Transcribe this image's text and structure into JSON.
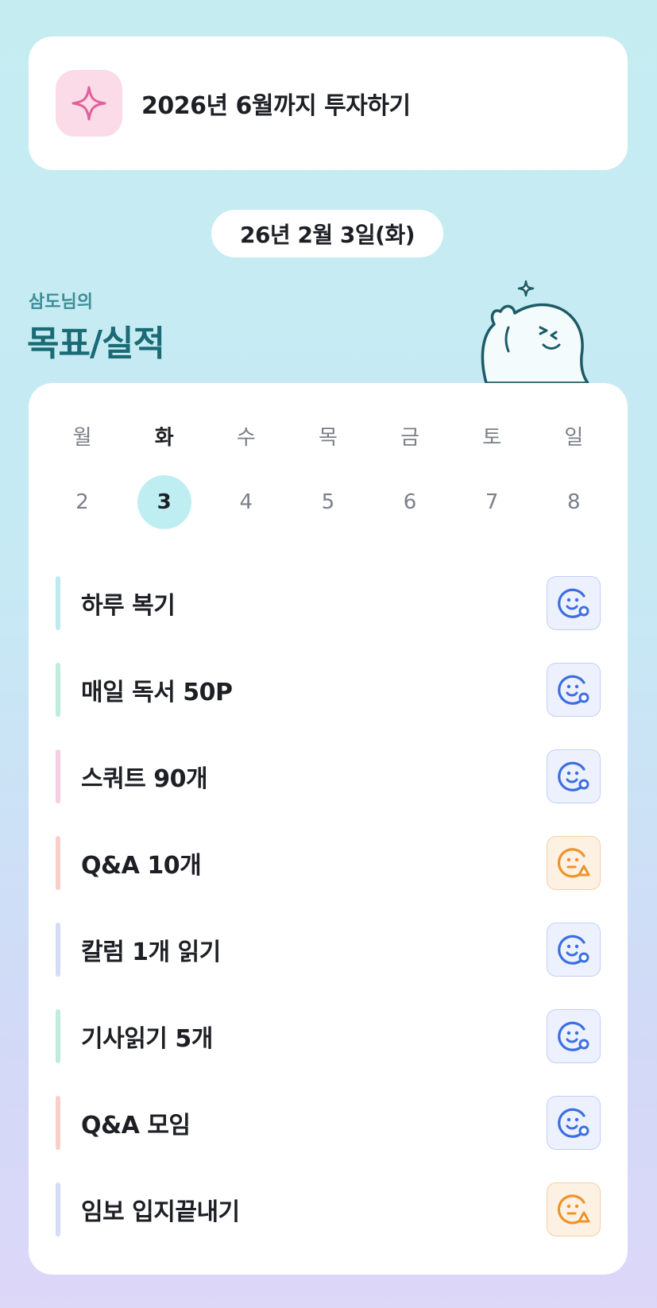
{
  "goal": {
    "text": "2026년 6월까지 투자하기",
    "icon": "sparkle-icon",
    "icon_color": "#e0609a",
    "icon_bg": "#fadbe7"
  },
  "date_label": "26년 2월 3일(화)",
  "header": {
    "subtitle": "삼도님의",
    "title": "목표/실적"
  },
  "week": {
    "days": [
      {
        "dow": "월",
        "date": "2",
        "active": false
      },
      {
        "dow": "화",
        "date": "3",
        "active": true
      },
      {
        "dow": "수",
        "date": "4",
        "active": false
      },
      {
        "dow": "목",
        "date": "5",
        "active": false
      },
      {
        "dow": "금",
        "date": "6",
        "active": false
      },
      {
        "dow": "토",
        "date": "7",
        "active": false
      },
      {
        "dow": "일",
        "date": "8",
        "active": false
      }
    ]
  },
  "tasks": [
    {
      "label": "하루 복기",
      "bar_color": "#bfeaf0",
      "status": "good"
    },
    {
      "label": "매일 독서 50P",
      "bar_color": "#bfecdc",
      "status": "good"
    },
    {
      "label": "스쿼트 90개",
      "bar_color": "#f6cfe4",
      "status": "good"
    },
    {
      "label": "Q&A 10개",
      "bar_color": "#f8cfcb",
      "status": "warn"
    },
    {
      "label": "칼럼 1개 읽기",
      "bar_color": "#d4dcf6",
      "status": "good"
    },
    {
      "label": "기사읽기 5개",
      "bar_color": "#bfecdc",
      "status": "good"
    },
    {
      "label": "Q&A 모임",
      "bar_color": "#f8cfcb",
      "status": "good"
    },
    {
      "label": "임보 입지끝내기",
      "bar_color": "#d4dcf6",
      "status": "warn"
    }
  ],
  "status_icons": {
    "good": "smile-check-icon",
    "warn": "neutral-warning-icon"
  },
  "colors": {
    "good": "#3b6fe0",
    "warn": "#f0922a",
    "accent": "#1a6b76",
    "active_day_bg": "#bfeef2"
  }
}
